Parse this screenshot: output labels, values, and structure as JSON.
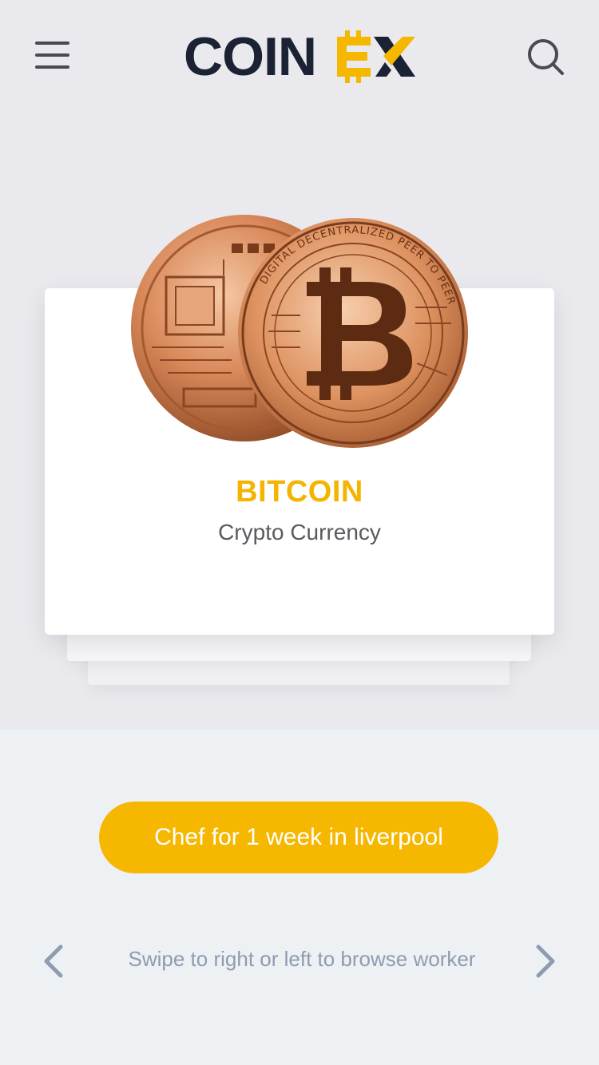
{
  "header": {
    "logo_text_main": "COIN",
    "logo_text_accent": "EX",
    "menu_icon": "hamburger-menu-icon",
    "search_icon": "search-icon"
  },
  "card": {
    "title": "BITCOIN",
    "subtitle": "Crypto Currency",
    "image_icon": "bitcoin-coins-image",
    "coin_ring_text": "DIGITAL DECENTRALIZED PEER TO PEER"
  },
  "cta": {
    "label": "Chef for 1 week in liverpool"
  },
  "footer": {
    "hint": "Swipe to right or left to browse worker",
    "prev_icon": "chevron-left-icon",
    "next_icon": "chevron-right-icon"
  },
  "colors": {
    "accent": "#f6b701",
    "title": "#f4b400",
    "logo_dark": "#1b2233",
    "hint": "#8f9bb0"
  }
}
